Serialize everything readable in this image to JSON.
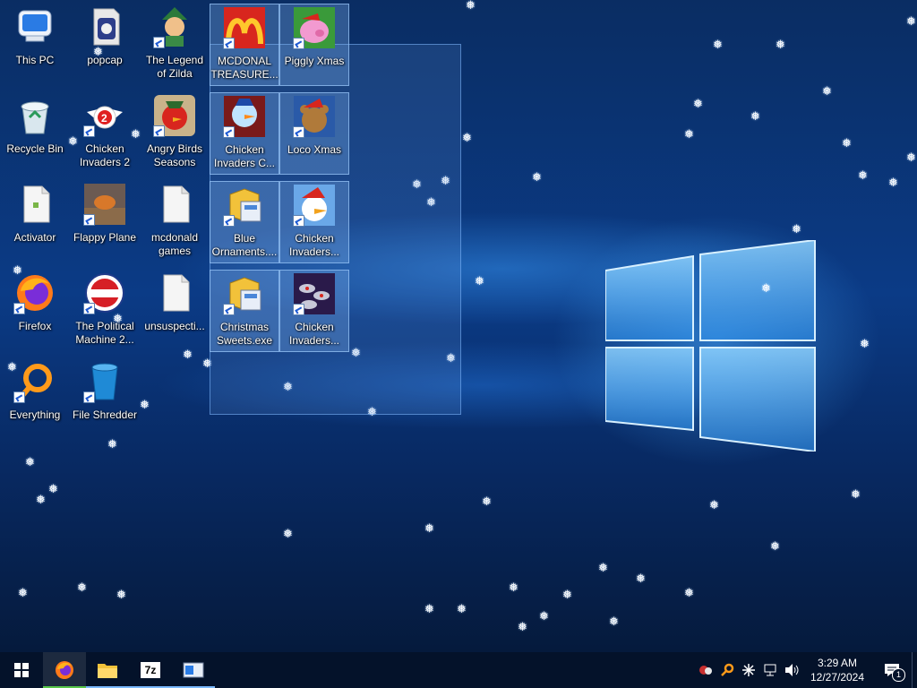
{
  "desktop": {
    "icons": [
      {
        "label": "This PC",
        "icon": "this-pc-icon"
      },
      {
        "label": "Recycle Bin",
        "icon": "recycle-bin-icon"
      },
      {
        "label": "Activator",
        "icon": "file-icon"
      },
      {
        "label": "Firefox",
        "icon": "firefox-icon"
      },
      {
        "label": "Everything",
        "icon": "everything-search-icon"
      },
      {
        "label": "popcap",
        "icon": "popcap-icon"
      },
      {
        "label": "Chicken Invaders 2",
        "icon": "chicken-invaders-icon"
      },
      {
        "label": "Flappy Plane",
        "icon": "flappy-plane-icon"
      },
      {
        "label": "The Political Machine 2...",
        "icon": "political-machine-icon"
      },
      {
        "label": "File Shredder",
        "icon": "file-shredder-icon"
      },
      {
        "label": "The Legend of Zilda",
        "icon": "zilda-icon"
      },
      {
        "label": "Angry Birds Seasons",
        "icon": "angry-birds-icon"
      },
      {
        "label": "mcdonald games",
        "icon": "file-icon"
      },
      {
        "label": "unsuspecti...",
        "icon": "file-icon"
      },
      {
        "label": "MCDONAL TREASURE...",
        "icon": "mcdonalds-icon"
      },
      {
        "label": "Chicken Invaders C...",
        "icon": "snowman-icon"
      },
      {
        "label": "Blue Ornaments....",
        "icon": "puzzle-icon"
      },
      {
        "label": "Christmas Sweets.exe",
        "icon": "puzzle-icon"
      },
      {
        "label": "Piggly Xmas",
        "icon": "pig-icon"
      },
      {
        "label": "Loco Xmas",
        "icon": "bear-icon"
      },
      {
        "label": "Chicken Invaders...",
        "icon": "chicken-santa-icon"
      },
      {
        "label": "Chicken Invaders...",
        "icon": "spaceships-icon"
      }
    ]
  },
  "taskbar": {
    "apps": [
      {
        "name": "Firefox",
        "icon": "firefox-icon"
      },
      {
        "name": "File Explorer",
        "icon": "folder-icon"
      },
      {
        "name": "7-Zip",
        "icon": "seven-zip-icon"
      },
      {
        "name": "Window",
        "icon": "window-icon"
      }
    ],
    "seven_zip_text": "7z",
    "clock_time": "3:29 AM",
    "clock_date": "12/27/2024",
    "notification_count": "1"
  },
  "colors": {
    "taskbar": "#04122a",
    "accent": "#7ab8ff",
    "selection": "#78aae6"
  }
}
